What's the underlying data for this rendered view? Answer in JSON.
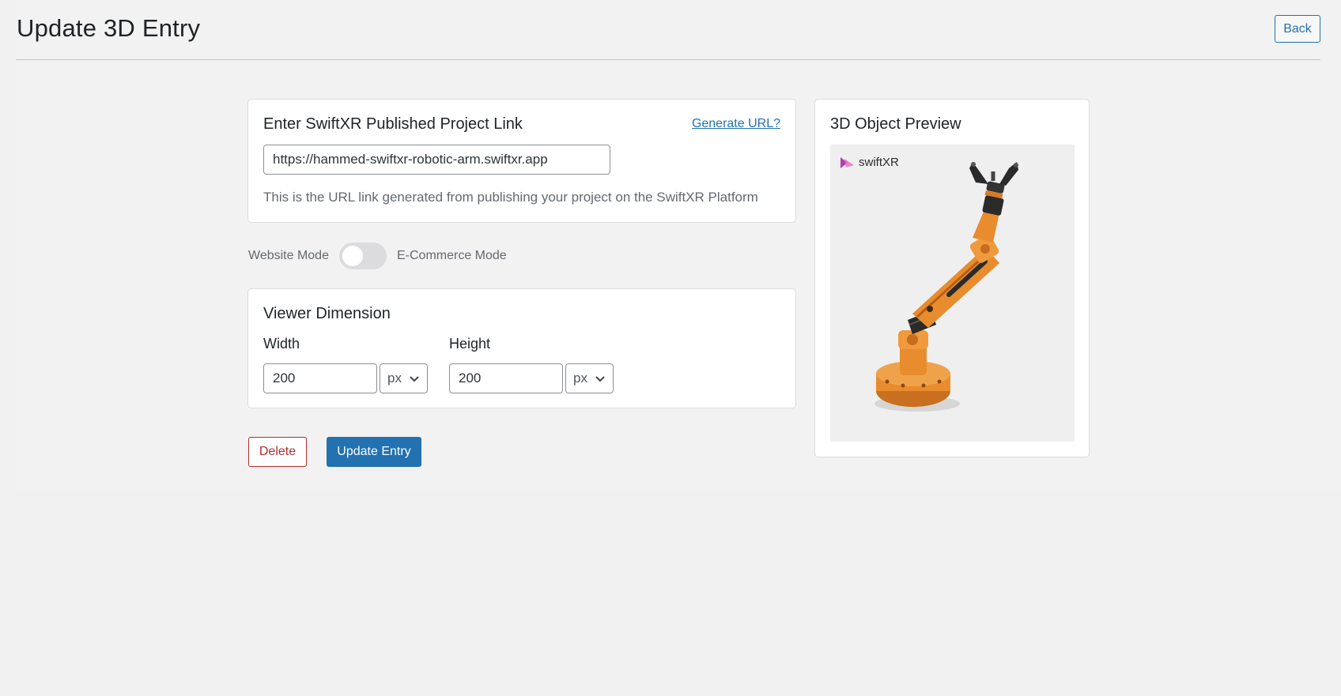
{
  "page": {
    "title": "Update 3D Entry",
    "back_label": "Back"
  },
  "link_card": {
    "title": "Enter SwiftXR Published Project Link",
    "generate_link": "Generate URL?",
    "url_value": "https://hammed-swiftxr-robotic-arm.swiftxr.app",
    "help_text": "This is the URL link generated from publishing your project on the SwiftXR Platform"
  },
  "mode": {
    "left_label": "Website Mode",
    "right_label": "E-Commerce Mode",
    "ecommerce_enabled": false
  },
  "dimension_card": {
    "title": "Viewer Dimension",
    "width": {
      "label": "Width",
      "value": "200",
      "unit": "px"
    },
    "height": {
      "label": "Height",
      "value": "200",
      "unit": "px"
    }
  },
  "actions": {
    "delete_label": "Delete",
    "update_label": "Update Entry"
  },
  "preview_card": {
    "title": "3D Object Preview",
    "brand_name": "swiftXR"
  },
  "colors": {
    "accent": "#2271b1",
    "danger": "#b32d2e",
    "arm_orange": "#e88c2e"
  }
}
